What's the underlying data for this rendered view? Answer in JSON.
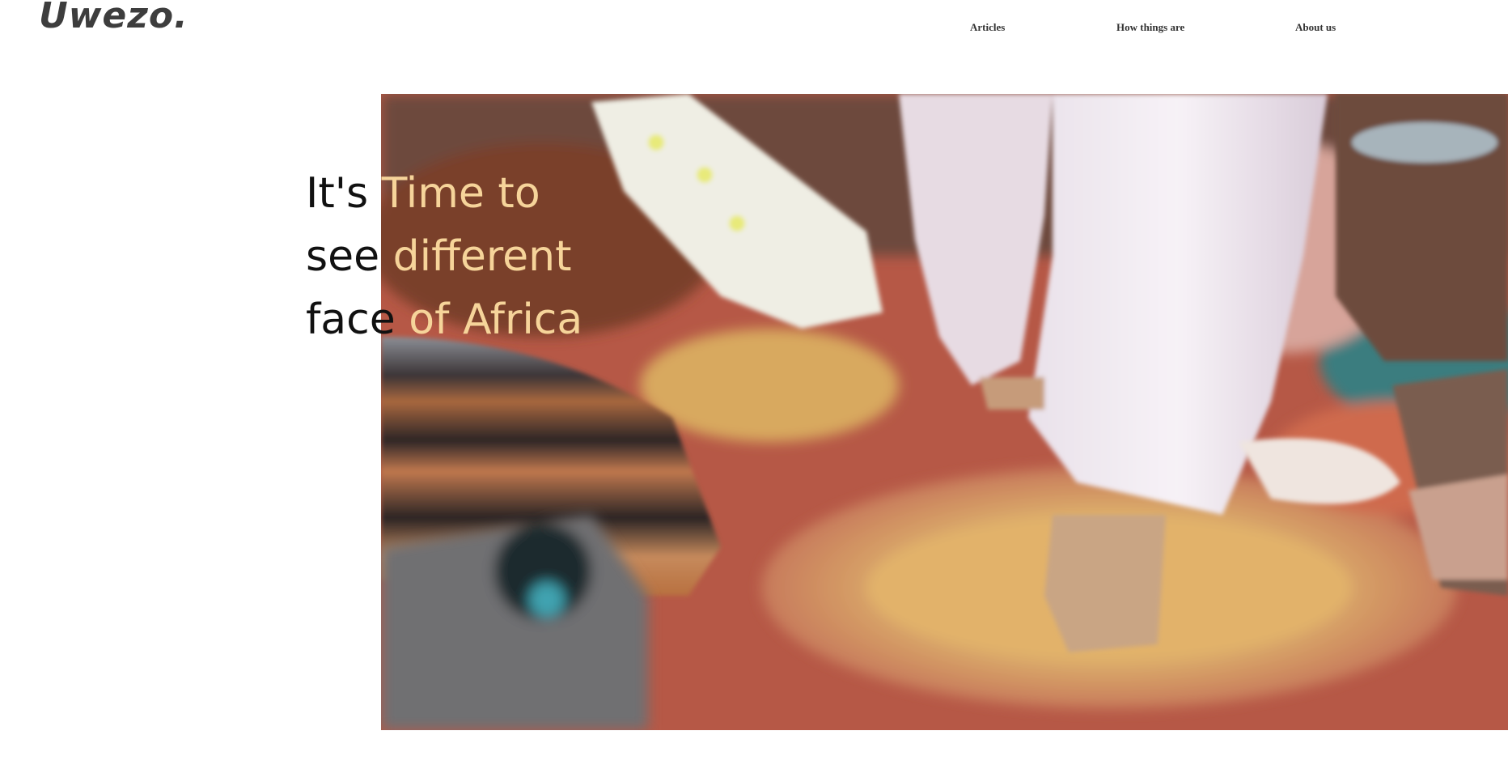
{
  "brand": {
    "logo": "Uwezo."
  },
  "nav": {
    "items": [
      {
        "label": "Articles"
      },
      {
        "label": "How things are"
      },
      {
        "label": "About us"
      }
    ]
  },
  "hero": {
    "headline": [
      {
        "plain": "It's ",
        "highlight": "Time to"
      },
      {
        "plain": "see ",
        "highlight": "different"
      },
      {
        "plain": "face ",
        "highlight": "of Africa"
      }
    ],
    "image_alt": "Feet in white trousers walking over colorful woven rugs and cushions"
  },
  "colors": {
    "text": "#111111",
    "highlight": "#f6d49a",
    "nav_text": "#333333",
    "logo": "#3d3d3d"
  }
}
